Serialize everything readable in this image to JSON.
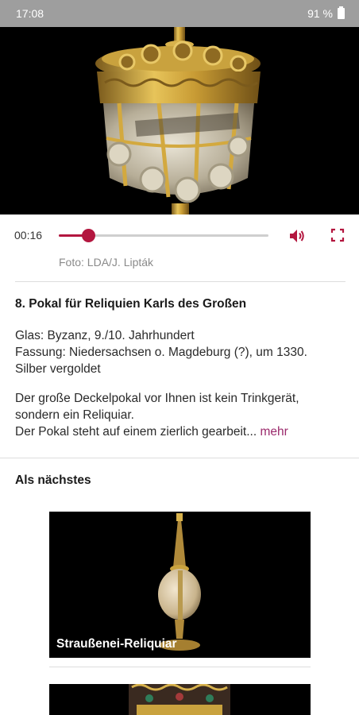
{
  "status_bar": {
    "time": "17:08",
    "battery": "91 %"
  },
  "player": {
    "elapsed": "00:16",
    "progress": 0.14,
    "accent_color": "#b3163f"
  },
  "photo_credit": "Foto: LDA/J. Lipták",
  "object": {
    "title": "8. Pokal für Reliquien Karls des Großen",
    "meta_lines": [
      "Glas: Byzanz, 9./10. Jahrhundert",
      "Fassung: Niedersachsen o. Magdeburg (?), um 1330.",
      "Silber vergoldet"
    ],
    "description_lines": [
      "Der große Deckelpokal vor Ihnen ist kein Trinkgerät,",
      "sondern ein Reliquiar.",
      "Der Pokal steht auf einem zierlich gearbeit..."
    ],
    "more_label": "mehr",
    "more_color": "#9b2a6c"
  },
  "next": {
    "heading": "Als nächstes",
    "items": [
      {
        "label": "Straußenei-Reliquiar"
      },
      {
        "label": ""
      }
    ]
  },
  "icons": [
    "volume-icon",
    "fullscreen-icon",
    "battery-icon"
  ]
}
